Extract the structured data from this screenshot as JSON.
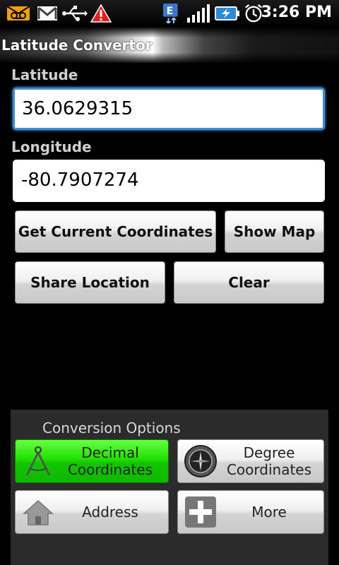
{
  "status_bar": {
    "time": "3:26 PM",
    "icons": [
      "voicemail-icon",
      "gmail-icon",
      "usb-icon",
      "warning-icon",
      "edge-network-icon",
      "signal-icon",
      "battery-charging-icon",
      "alarm-icon"
    ]
  },
  "app": {
    "title": "Latitude Convertor"
  },
  "latitude": {
    "label": "Latitude",
    "value": "36.0629315"
  },
  "longitude": {
    "label": "Longitude",
    "value": "-80.7907274"
  },
  "buttons": {
    "get_coords": "Get Current Coordinates",
    "show_map": "Show Map",
    "share": "Share Location",
    "clear": "Clear"
  },
  "options": {
    "title": "Conversion Options",
    "decimal_line1": "Decimal",
    "decimal_line2": "Coordinates",
    "degree_line1": "Degree",
    "degree_line2": "Coordinates",
    "address": "Address",
    "more": "More"
  },
  "colors": {
    "accent_focus": "#3a8fd8",
    "active_option": "#22e000"
  }
}
